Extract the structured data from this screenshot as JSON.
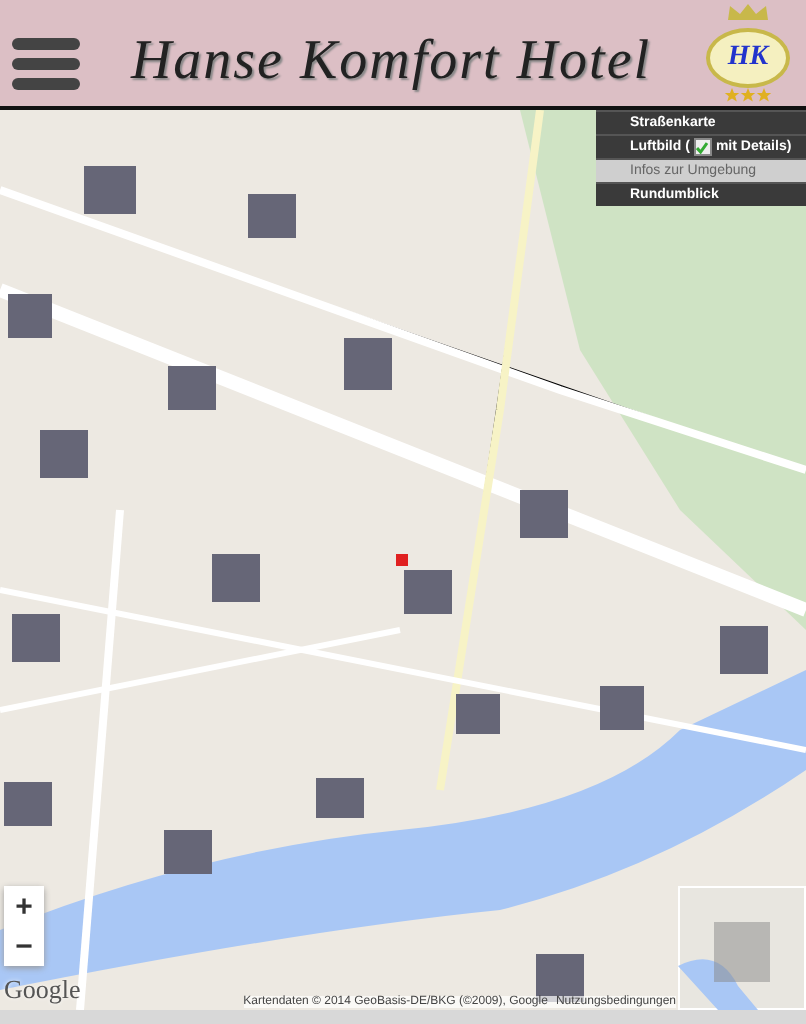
{
  "header": {
    "title": "Hanse Komfort Hotel",
    "logo_text": "HK"
  },
  "map_menu": [
    {
      "kind": "plain",
      "label": "Straßenkarte",
      "selected": false
    },
    {
      "kind": "checkbox",
      "label": "Luftbild (",
      "suffix": "mit Details)",
      "checked": true,
      "selected": false
    },
    {
      "kind": "plain",
      "label": "Infos zur Umgebung",
      "selected": true
    },
    {
      "kind": "plain",
      "label": "Rundumblick",
      "selected": false
    }
  ],
  "zoom": {
    "in": "+",
    "out": "−"
  },
  "map_logo": "Google",
  "attribution": {
    "text": "Kartendaten © 2014 GeoBasis-DE/BKG (©2009), Google",
    "link": "Nutzungsbedingungen"
  }
}
